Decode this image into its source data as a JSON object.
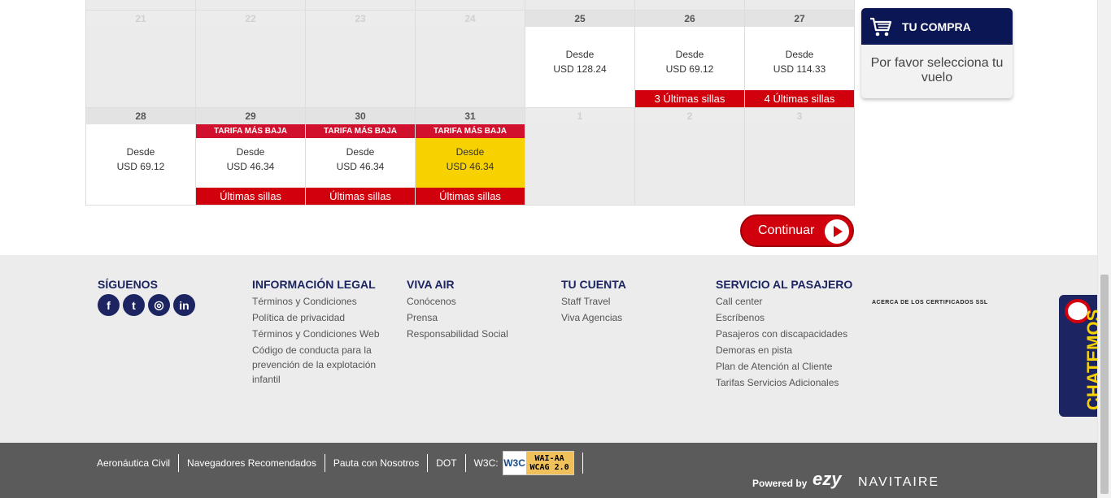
{
  "calendar": {
    "top_strip": [
      "",
      "",
      "",
      "",
      "",
      "",
      ""
    ],
    "week1": [
      {
        "day": "21",
        "past": true
      },
      {
        "day": "22",
        "past": true
      },
      {
        "day": "23",
        "past": true
      },
      {
        "day": "24",
        "past": true
      },
      {
        "day": "25",
        "past": false,
        "desde": "Desde",
        "price": "USD 128.24"
      },
      {
        "day": "26",
        "past": false,
        "desde": "Desde",
        "price": "USD 69.12",
        "bottom": "3 Últimas sillas"
      },
      {
        "day": "27",
        "past": false,
        "desde": "Desde",
        "price": "USD 114.33",
        "bottom": "4 Últimas sillas"
      }
    ],
    "week2": [
      {
        "day": "28",
        "past": false,
        "desde": "Desde",
        "price": "USD 69.12"
      },
      {
        "day": "29",
        "past": false,
        "tarifa": "TARIFA MÁS BAJA",
        "desde": "Desde",
        "price": "USD 46.34",
        "bottom": "Últimas sillas"
      },
      {
        "day": "30",
        "past": false,
        "tarifa": "TARIFA MÁS BAJA",
        "desde": "Desde",
        "price": "USD 46.34",
        "bottom": "Últimas sillas"
      },
      {
        "day": "31",
        "past": false,
        "selected": true,
        "tarifa": "TARIFA MÁS BAJA",
        "desde": "Desde",
        "price": "USD 46.34",
        "bottom": "Últimas sillas"
      },
      {
        "day": "1",
        "past": true
      },
      {
        "day": "2",
        "past": true
      },
      {
        "day": "3",
        "past": true
      }
    ]
  },
  "tucompra": {
    "title": "TU COMPRA",
    "message": "Por favor selecciona tu vuelo",
    "icon": "cart-icon"
  },
  "continuar": {
    "label": "Continuar",
    "icon": "play-icon"
  },
  "footer": {
    "siguenos": {
      "title": "SÍGUENOS",
      "icons": [
        "f",
        "t",
        "◎",
        "in"
      ],
      "icon_names": [
        "facebook-icon",
        "twitter-icon",
        "instagram-icon",
        "linkedin-icon"
      ]
    },
    "legal": {
      "title": "INFORMACIÓN LEGAL",
      "links": [
        "Términos y Condiciones",
        "Política de privacidad",
        "Términos y Condiciones Web",
        "Código de conducta para la prevención de la explotación infantil"
      ]
    },
    "vivaair": {
      "title": "VIVA AIR",
      "links": [
        "Conócenos",
        "Prensa",
        "Responsabilidad Social"
      ]
    },
    "cuenta": {
      "title": "TU CUENTA",
      "links": [
        "Staff Travel",
        "Viva Agencias"
      ]
    },
    "servicio": {
      "title": "SERVICIO AL PASAJERO",
      "links": [
        "Call center",
        "Escríbenos",
        "Pasajeros con discapacidades",
        "Demoras en pista",
        "Plan de Atención al Cliente",
        "Tarifas Servicios Adicionales"
      ]
    },
    "ssl": "ACERCA DE LOS CERTIFICADOS SSL"
  },
  "chat": {
    "label": "CHATEMOS",
    "icon": "chat-bubble-icon"
  },
  "bottombar": {
    "links": [
      "Aeronáutica Civil",
      "Navegadores Recomendados",
      "Pauta con Nosotros",
      "DOT"
    ],
    "w3c_label": "W3C:",
    "badge_left": "W3C",
    "badge_top": "WAI-AA",
    "badge_bottom": "WCAG 2.0",
    "powered": "Powered by",
    "ezy": "ezy",
    "navitaire": "NAVITAIRE"
  },
  "colors": {
    "brand_red": "#d0000c",
    "navy": "#1c2561",
    "selected_yellow": "#f7d200"
  }
}
